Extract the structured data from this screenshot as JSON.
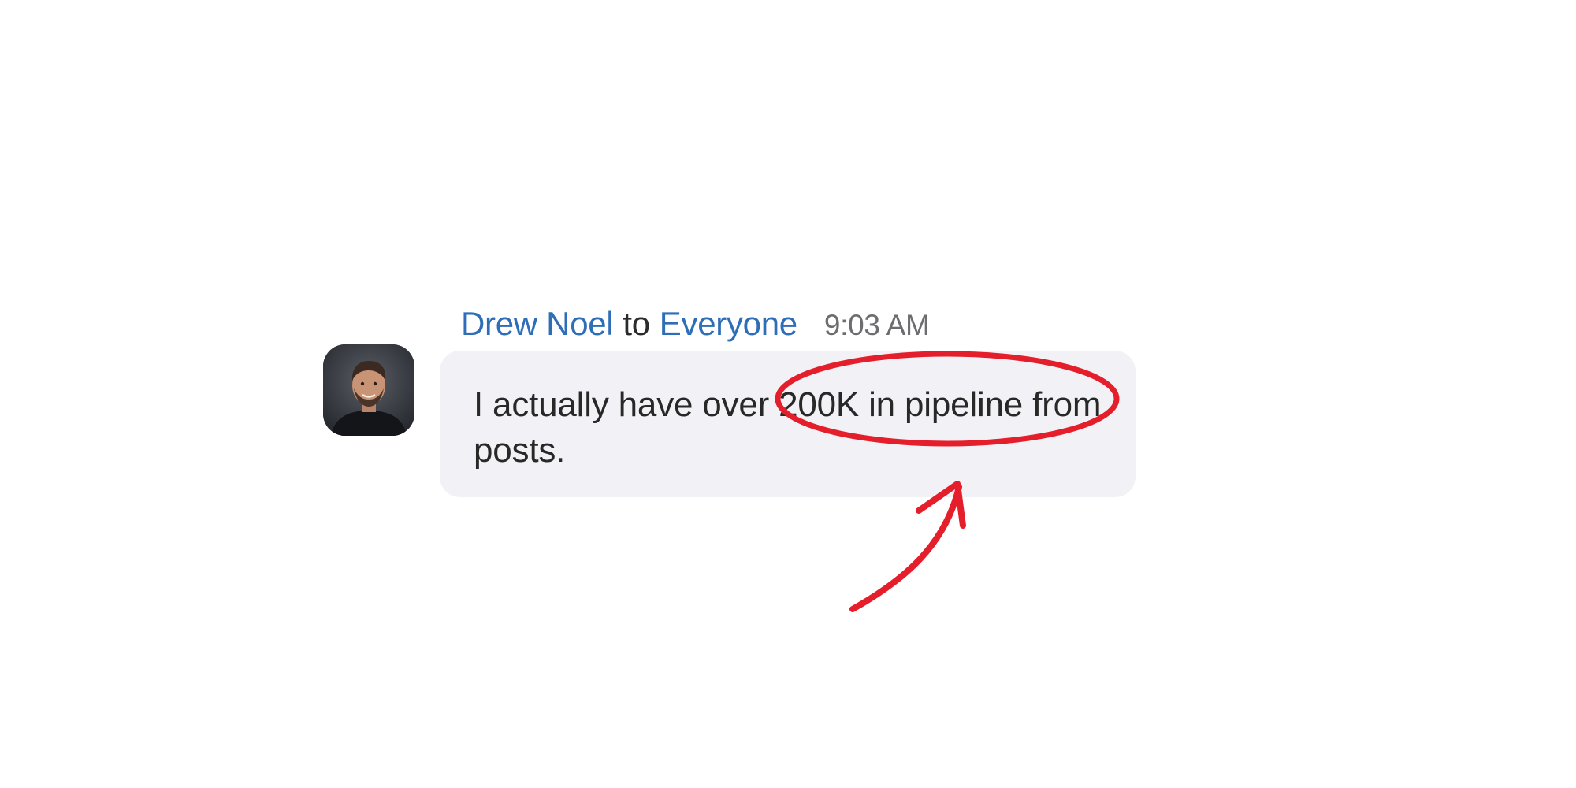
{
  "message": {
    "sender": "Drew Noel",
    "to_word": "to",
    "recipient": "Everyone",
    "timestamp": "9:03 AM",
    "text_before_highlight": "I actually have over ",
    "highlighted_text": "200K in pipeline",
    "text_after_highlight": " from posts."
  },
  "avatar": {
    "icon": "user-photo"
  },
  "annotation": {
    "color": "#e41e2b",
    "shapes": [
      "ellipse-highlight",
      "arrow-pointer"
    ]
  }
}
